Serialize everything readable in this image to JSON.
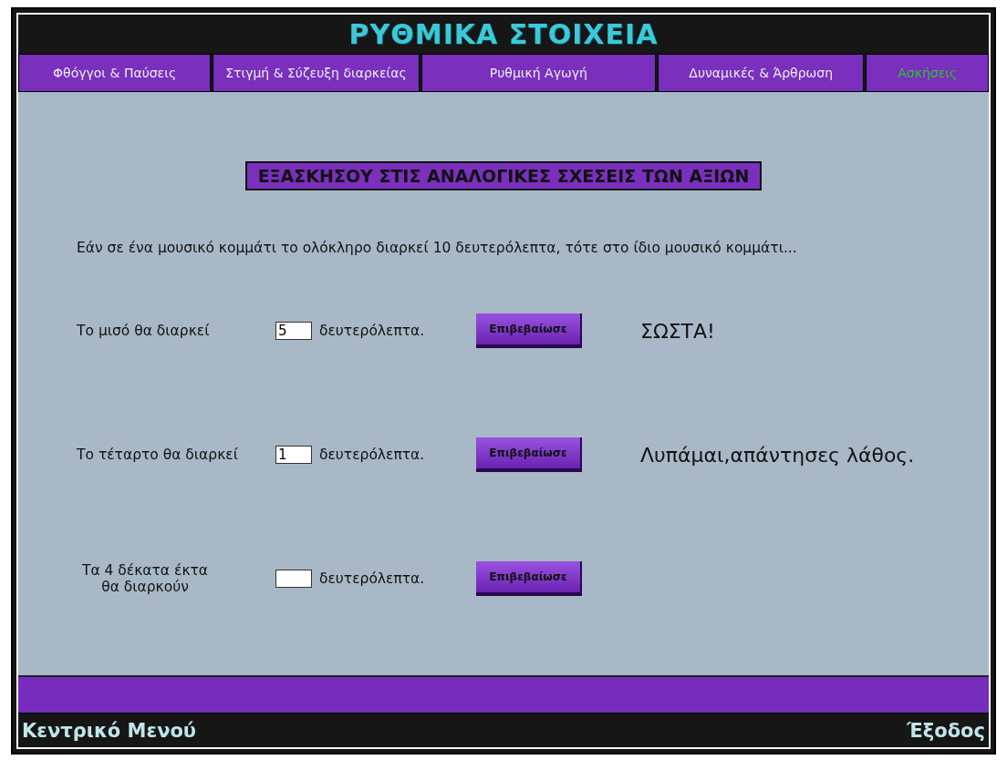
{
  "title": "ΡΥΘΜΙΚΑ ΣΤΟΙΧΕΙΑ",
  "tabs": [
    {
      "label": "Φθόγγοι & Παύσεις",
      "selected": false
    },
    {
      "label": "Στιγμή & Σύζευξη διαρκείας",
      "selected": false
    },
    {
      "label": "Ρυθμική Αγωγή",
      "selected": false
    },
    {
      "label": "Δυναμικές & Άρθρωση",
      "selected": false
    },
    {
      "label": "Ασκήσεις",
      "selected": true
    }
  ],
  "heading": "ΕΞΑΣΚΗΣΟΥ ΣΤΙΣ ΑΝΑΛΟΓΙΚΕΣ ΣΧΕΣΕΙΣ ΤΩΝ ΑΞΙΩΝ",
  "intro": "Εάν σε ένα μουσικό κομμάτι το ολόκληρο διαρκεί 10 δευτερόλεπτα, τότε στο ίδιο μουσικό κομμάτι...",
  "questions": [
    {
      "label": "Το μισό θα διαρκεί",
      "value": "5",
      "unit": "δευτερόλεπτα.",
      "button": "Επιβεβαίωσε",
      "feedback": "ΣΩΣΤΑ!"
    },
    {
      "label": "Το τέταρτο θα διαρκεί",
      "value": "1",
      "unit": "δευτερόλεπτα.",
      "button": "Επιβεβαίωσε",
      "feedback": "Λυπάμαι,απάντησες λάθος."
    },
    {
      "label": "Τα 4 δέκατα έκτα θα διαρκούν",
      "unit": "δευτερόλεπτα.",
      "button": "Επιβεβαίωσε"
    }
  ],
  "footer": {
    "menu_link": "Κεντρικό Μενού",
    "exit_link": "Έξοδος"
  }
}
